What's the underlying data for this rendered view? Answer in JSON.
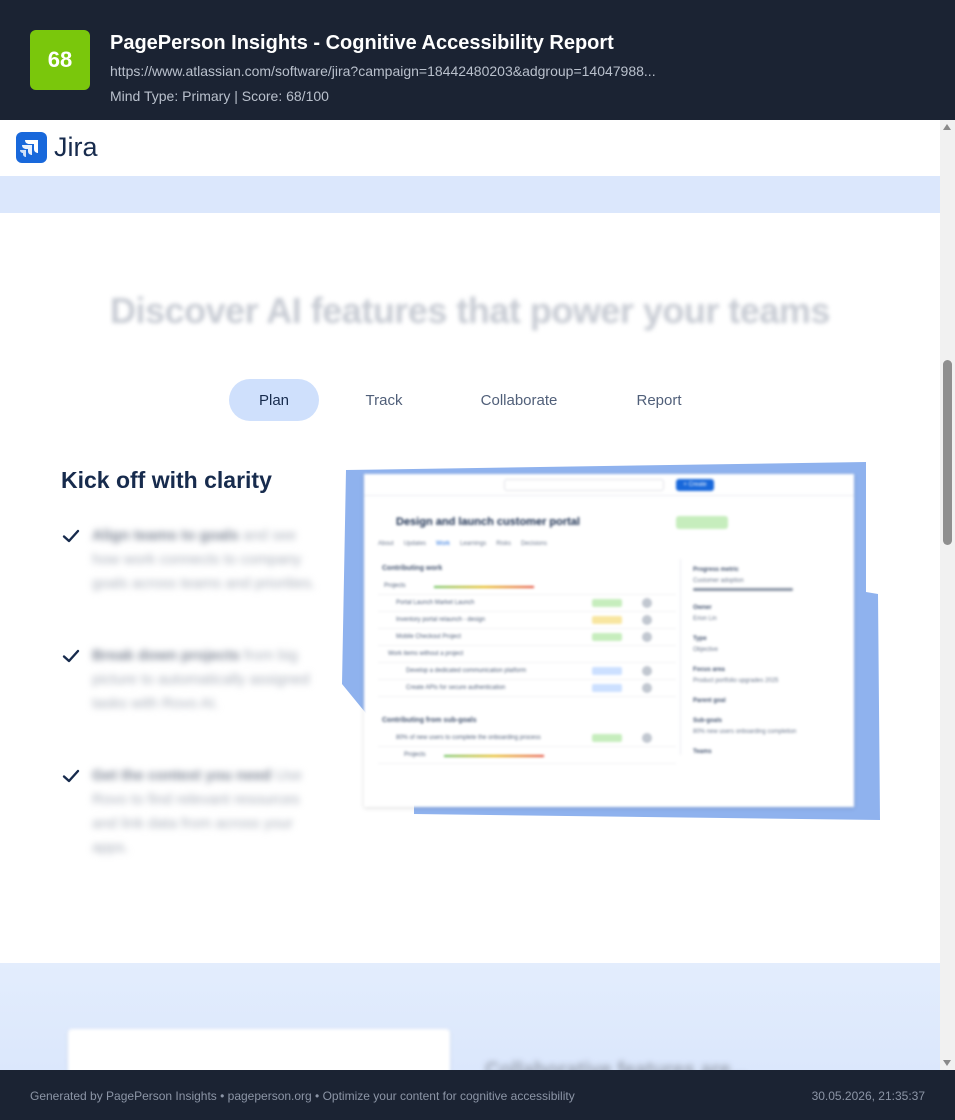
{
  "report": {
    "score": "68",
    "title": "PagePerson Insights - Cognitive Accessibility Report",
    "url": "https://www.atlassian.com/software/jira?campaign=18442480203&adgroup=14047988...",
    "meta": "Mind Type: Primary | Score: 68/100",
    "score_color": "#7ac70c"
  },
  "page": {
    "logo": {
      "icon": "jira-logo-icon",
      "wordmark": "Jira"
    },
    "hero_heading": "Discover AI features that power your teams",
    "tabs": [
      {
        "label": "Plan",
        "active": true
      },
      {
        "label": "Track",
        "active": false
      },
      {
        "label": "Collaborate",
        "active": false
      },
      {
        "label": "Report",
        "active": false
      }
    ],
    "feature_title": "Kick off with clarity",
    "features": [
      {
        "icon": "check-icon",
        "bold": "Align teams to goals",
        "text": " and see how work connects to company goals across teams and priorities."
      },
      {
        "icon": "check-icon",
        "bold": "Break down projects",
        "text": " from big picture to automatically assigned tasks with Rovo AI."
      },
      {
        "icon": "check-icon",
        "bold": "Get the context you need",
        "text": " Use Rovo to find relevant resources and link data from across your apps."
      }
    ],
    "product_shot": {
      "search": "Search",
      "create": "+ Create",
      "title": "Design and launch customer portal",
      "status": "On track",
      "tabs": [
        "About",
        "Updates",
        "Work",
        "Learnings",
        "Risks",
        "Decisions"
      ],
      "section_work": "Contributing work",
      "rows": [
        {
          "text": "Projects",
          "status": "On track",
          "status_color": ""
        },
        {
          "text": "Portal Launch Market Launch",
          "status": "ON TRACK",
          "status_color": "#c6edbd"
        },
        {
          "text": "Inventory portal relaunch - design",
          "status": "AT RISK",
          "status_color": "#f8e6a0"
        },
        {
          "text": "Mobile Checkout Project",
          "status": "ON TRACK",
          "status_color": "#c6edbd"
        },
        {
          "text": "Work items without a project",
          "status": "",
          "status_color": ""
        },
        {
          "text": "Develop a dedicated communication platform",
          "status": "IN PROGRESS",
          "status_color": "#cce0ff"
        },
        {
          "text": "Create APIs for secure authentication",
          "status": "IN PROGRESS",
          "status_color": "#cce0ff"
        }
      ],
      "section_subgoals": "Contributing from sub-goals",
      "sub_rows": [
        {
          "text": "80% of new users to complete the onboarding process",
          "status": "ON TRACK",
          "status_color": "#c6edbd"
        },
        {
          "text": "Projects",
          "status": "On track",
          "status_color": ""
        }
      ],
      "side": [
        {
          "label": "Progress metric",
          "value": "Customer adoption"
        },
        {
          "label": "Owner",
          "value": "Erion Lin"
        },
        {
          "label": "Type",
          "value": "Objective"
        },
        {
          "label": "Focus area",
          "value": "Product portfolio upgrades 2025"
        },
        {
          "label": "Parent goal",
          "value": ""
        },
        {
          "label": "Sub-goals",
          "value": "80% new users onboarding completion"
        },
        {
          "label": "Teams",
          "value": ""
        }
      ]
    },
    "lower_heading": "Collaborative features are..."
  },
  "footer": {
    "left": "Generated by PagePerson Insights • pageperson.org • Optimize your content for cognitive accessibility",
    "right": "30.05.2026, 21:35:37"
  },
  "colors": {
    "header_bg": "#1b2333",
    "accent_blue": "#1868db",
    "tab_active_bg": "#cfe0fc",
    "strip_blue": "#dbe7fc"
  }
}
